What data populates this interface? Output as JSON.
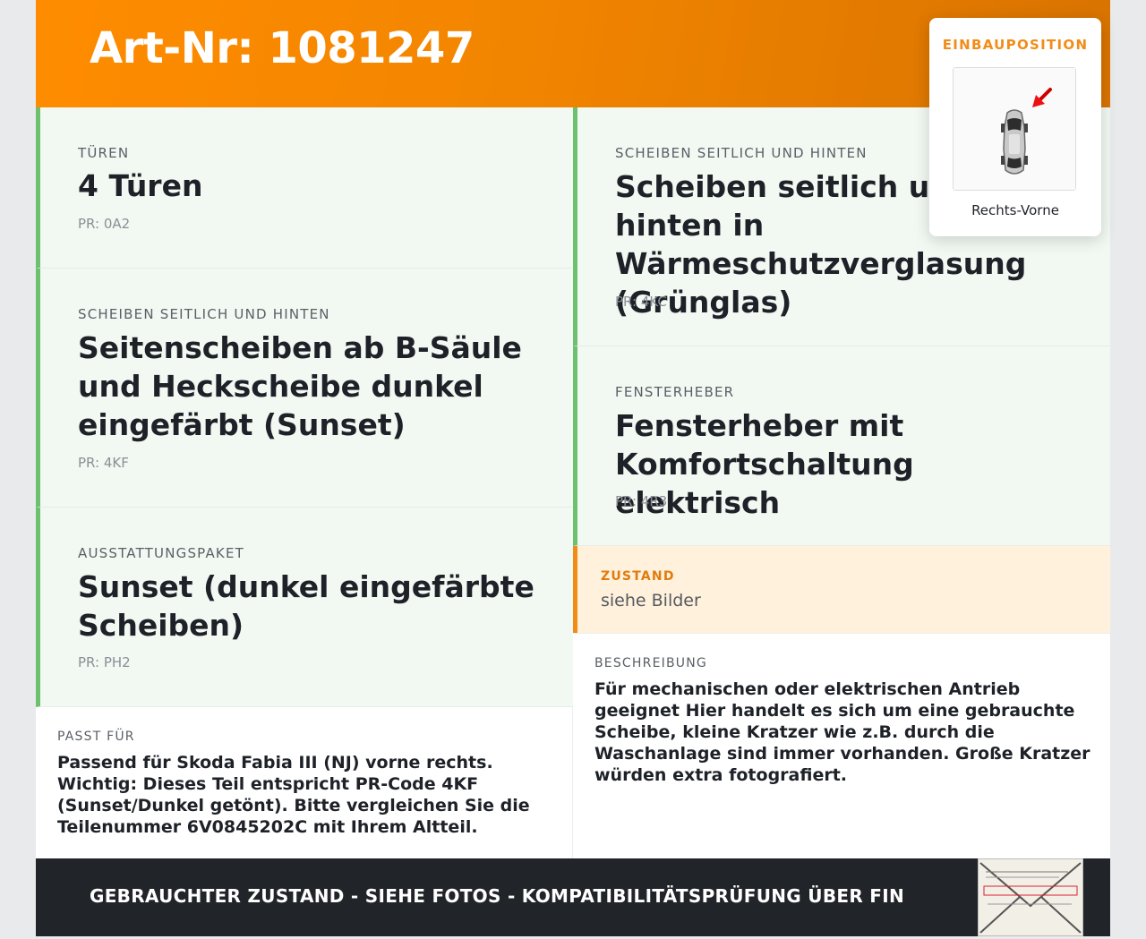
{
  "header": {
    "title": "Art-Nr: 1081247"
  },
  "left_cards": [
    {
      "label": "TÜREN",
      "title": "4 Türen",
      "pr": "PR: 0A2"
    },
    {
      "label": "SCHEIBEN SEITLICH UND HINTEN",
      "title": "Seitenscheiben ab B-Säule und Heckscheibe dunkel eingefärbt (Sunset)",
      "pr": "PR: 4KF"
    },
    {
      "label": "AUSSTATTUNGSPAKET",
      "title": "Sunset (dunkel eingefärbte Scheiben)",
      "pr": "PR: PH2"
    }
  ],
  "right_cards": [
    {
      "label": "SCHEIBEN SEITLICH UND HINTEN",
      "title": "Scheiben seitlich und hinten in Wärmeschutzverglasung (Grünglas)",
      "pr": "PR: 4KC"
    },
    {
      "label": "FENSTERHEBER",
      "title": "Fensterheber mit Komfortschaltung elektrisch",
      "pr": "PR: 4R3"
    }
  ],
  "zustand": {
    "label": "ZUSTAND",
    "value": "siehe Bilder"
  },
  "passt_fuer": {
    "label": "PASST FÜR",
    "text": "Passend für Skoda Fabia III (NJ) vorne rechts. Wichtig: Dieses Teil entspricht PR-Code 4KF (Sunset/Dunkel getönt). Bitte vergleichen Sie die Teilenummer 6V0845202C mit Ihrem Altteil."
  },
  "beschreibung": {
    "label": "BESCHREIBUNG",
    "text": "Für mechanischen oder elektrischen Antrieb geeignet Hier handelt es sich um eine gebrauchte Scheibe, kleine Kratzer wie z.B. durch die Waschanlage sind immer vorhanden. Große Kratzer würden extra fotografiert."
  },
  "footer": {
    "text": "GEBRAUCHTER ZUSTAND - SIEHE FOTOS - KOMPATIBILITÄTSPRÜFUNG ÜBER FIN"
  },
  "popup": {
    "title": "EINBAUPOSITION",
    "caption": "Rechts-Vorne"
  },
  "icons": {
    "car": "car-top-view-icon",
    "arrow": "position-arrow-icon",
    "stamp": "document-stamp-icon"
  },
  "colors": {
    "accent": "#f28c18",
    "green": "#6cc070",
    "dark": "#212428"
  }
}
